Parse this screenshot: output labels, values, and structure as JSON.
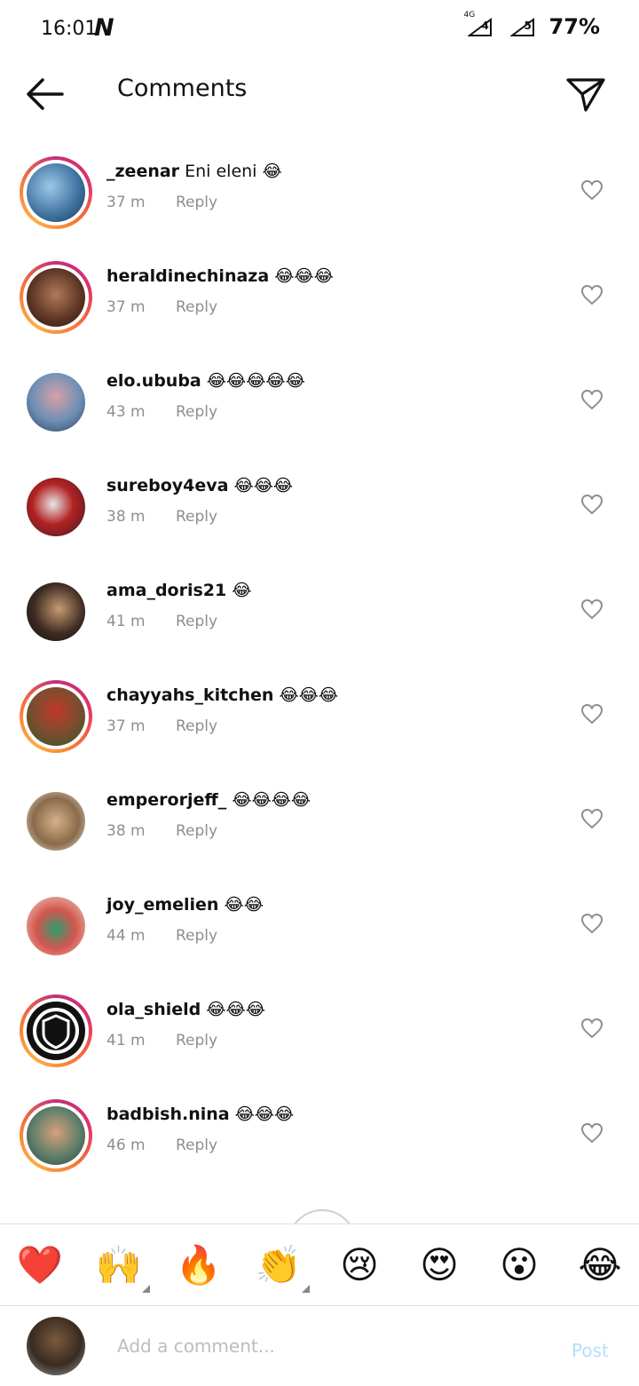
{
  "status_bar": {
    "time": "16:01",
    "carrier_glyph": "N",
    "network": "4G",
    "sim1": "4",
    "sim2": "5",
    "battery": "77%"
  },
  "header": {
    "title": "Comments",
    "back_icon": "arrow-left-icon",
    "send_icon": "paper-plane-icon"
  },
  "comments": [
    {
      "username": "_zeenar",
      "text": "Eni eleni",
      "emojis": "😂",
      "time": "37 m",
      "reply": "Reply",
      "story": true
    },
    {
      "username": "heraldinechinaza",
      "text": "",
      "emojis": "😂😂😂",
      "time": "37 m",
      "reply": "Reply",
      "story": true
    },
    {
      "username": "elo.ububa",
      "text": "",
      "emojis": "😂😂😂😂😂",
      "time": "43 m",
      "reply": "Reply",
      "story": false
    },
    {
      "username": "sureboy4eva",
      "text": "",
      "emojis": "😂😂😂",
      "time": "38 m",
      "reply": "Reply",
      "story": false
    },
    {
      "username": "ama_doris21",
      "text": "",
      "emojis": "😂",
      "time": "41 m",
      "reply": "Reply",
      "story": false
    },
    {
      "username": "chayyahs_kitchen",
      "text": "",
      "emojis": "😂😂😂",
      "time": "37 m",
      "reply": "Reply",
      "story": true
    },
    {
      "username": "emperorjeff_",
      "text": "",
      "emojis": "😂😂😂😂",
      "time": "38 m",
      "reply": "Reply",
      "story": false
    },
    {
      "username": "joy_emelien",
      "text": "",
      "emojis": "😂😂",
      "time": "44 m",
      "reply": "Reply",
      "story": false
    },
    {
      "username": "ola_shield",
      "text": "",
      "emojis": "😂😂😂",
      "time": "41 m",
      "reply": "Reply",
      "story": true
    },
    {
      "username": "badbish.nina",
      "text": "",
      "emojis": "😂😂😂",
      "time": "46 m",
      "reply": "Reply",
      "story": true
    }
  ],
  "emoji_bar": [
    "❤️",
    "🙌",
    "🔥",
    "👏",
    "😢",
    "😍",
    "😮",
    "😂"
  ],
  "input_bar": {
    "placeholder": "Add a comment...",
    "post_label": "Post"
  },
  "colors": {
    "story_ring": "#e1306c",
    "meta_text": "#8e8e8e",
    "post_disabled": "#b2dffc"
  }
}
